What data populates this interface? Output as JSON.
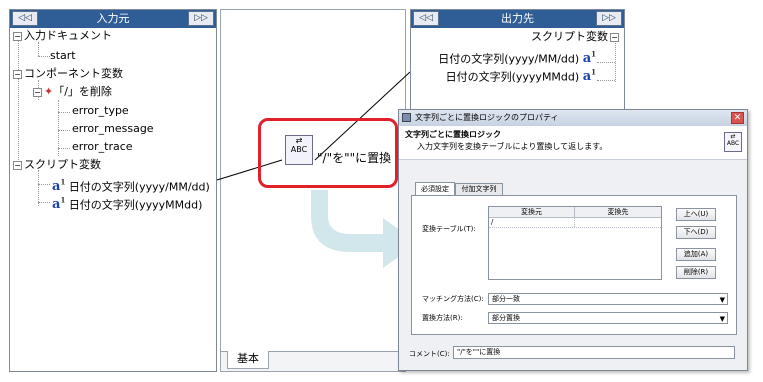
{
  "left_panel": {
    "title": "入力元",
    "prev": "◁◁",
    "next": "▷▷",
    "nodes": [
      "入力ドキュメント",
      "start",
      "コンポーネント変数",
      "「/」を削除",
      "error_type",
      "error_message",
      "error_trace",
      "スクリプト変数",
      "日付の文字列(yyyy/MM/dd)",
      "日付の文字列(yyyyMMdd)"
    ]
  },
  "right_panel": {
    "title": "出力先",
    "prev": "◁◁",
    "next": "▷▷",
    "nodes": [
      "スクリプト変数",
      "日付の文字列(yyyy/MM/dd)",
      "日付の文字列(yyyyMMdd)"
    ]
  },
  "canvas": {
    "component_label": "\"/\"を\"\"に置換",
    "tab_label": "基本",
    "highlight_color": "#e0202a",
    "arrow_color": "#cfe4ea"
  },
  "dialog": {
    "title": "文字列ごとに置換ロジックのプロパティ",
    "close": "✕",
    "heading": "文字列ごとに置換ロジック",
    "description": "入力文字列を変換テーブルにより置換して返します。",
    "tabs": [
      "必須設定",
      "付加文字列"
    ],
    "table_label": "変換テーブル(T):",
    "table_headers": [
      "変換元",
      "変換先"
    ],
    "table_rows": [
      [
        "/",
        ""
      ]
    ],
    "buttons": [
      "上へ(U)",
      "下へ(D)",
      "追加(A)",
      "削除(R)"
    ],
    "matching_label": "マッチング方法(C):",
    "matching_value": "部分一致",
    "replace_label": "置換方法(R):",
    "replace_value": "部分置換",
    "comment_label": "コメント(C):",
    "comment_value": "\"/\"を\"\"に置換"
  }
}
